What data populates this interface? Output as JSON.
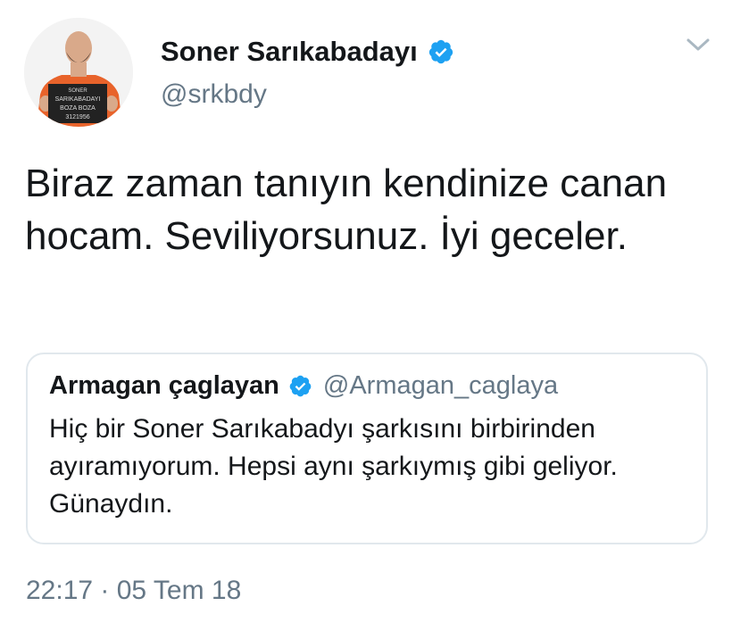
{
  "tweet": {
    "author": {
      "display_name": "Soner Sarıkabadayı",
      "handle": "@srkbdy",
      "verified": true,
      "avatar_sign_lines": [
        "SONER",
        "SARIKABADAYI",
        "BOZA BOZA",
        "3121956"
      ]
    },
    "text": "Biraz zaman tanıyın kendinize canan hocam. Seviliyorsunuz. İyi geceler.",
    "timestamp": "22:17 · 05 Tem 18",
    "menu_icon": "chevron-down-icon",
    "quoted": {
      "display_name": "Armagan çaglayan",
      "handle": "@Armagan_caglaya",
      "verified": true,
      "text": "Hiç bir Soner Sarıkabadyı şarkısını birbirinden ayıramıyorum. Hepsi aynı şarkıymış gibi geliyor. Günaydın."
    }
  },
  "colors": {
    "text_primary": "#14171a",
    "text_secondary": "#657786",
    "verified_blue": "#1da1f2",
    "border": "#e1e8ed",
    "avatar_jumpsuit": "#e8632b"
  }
}
